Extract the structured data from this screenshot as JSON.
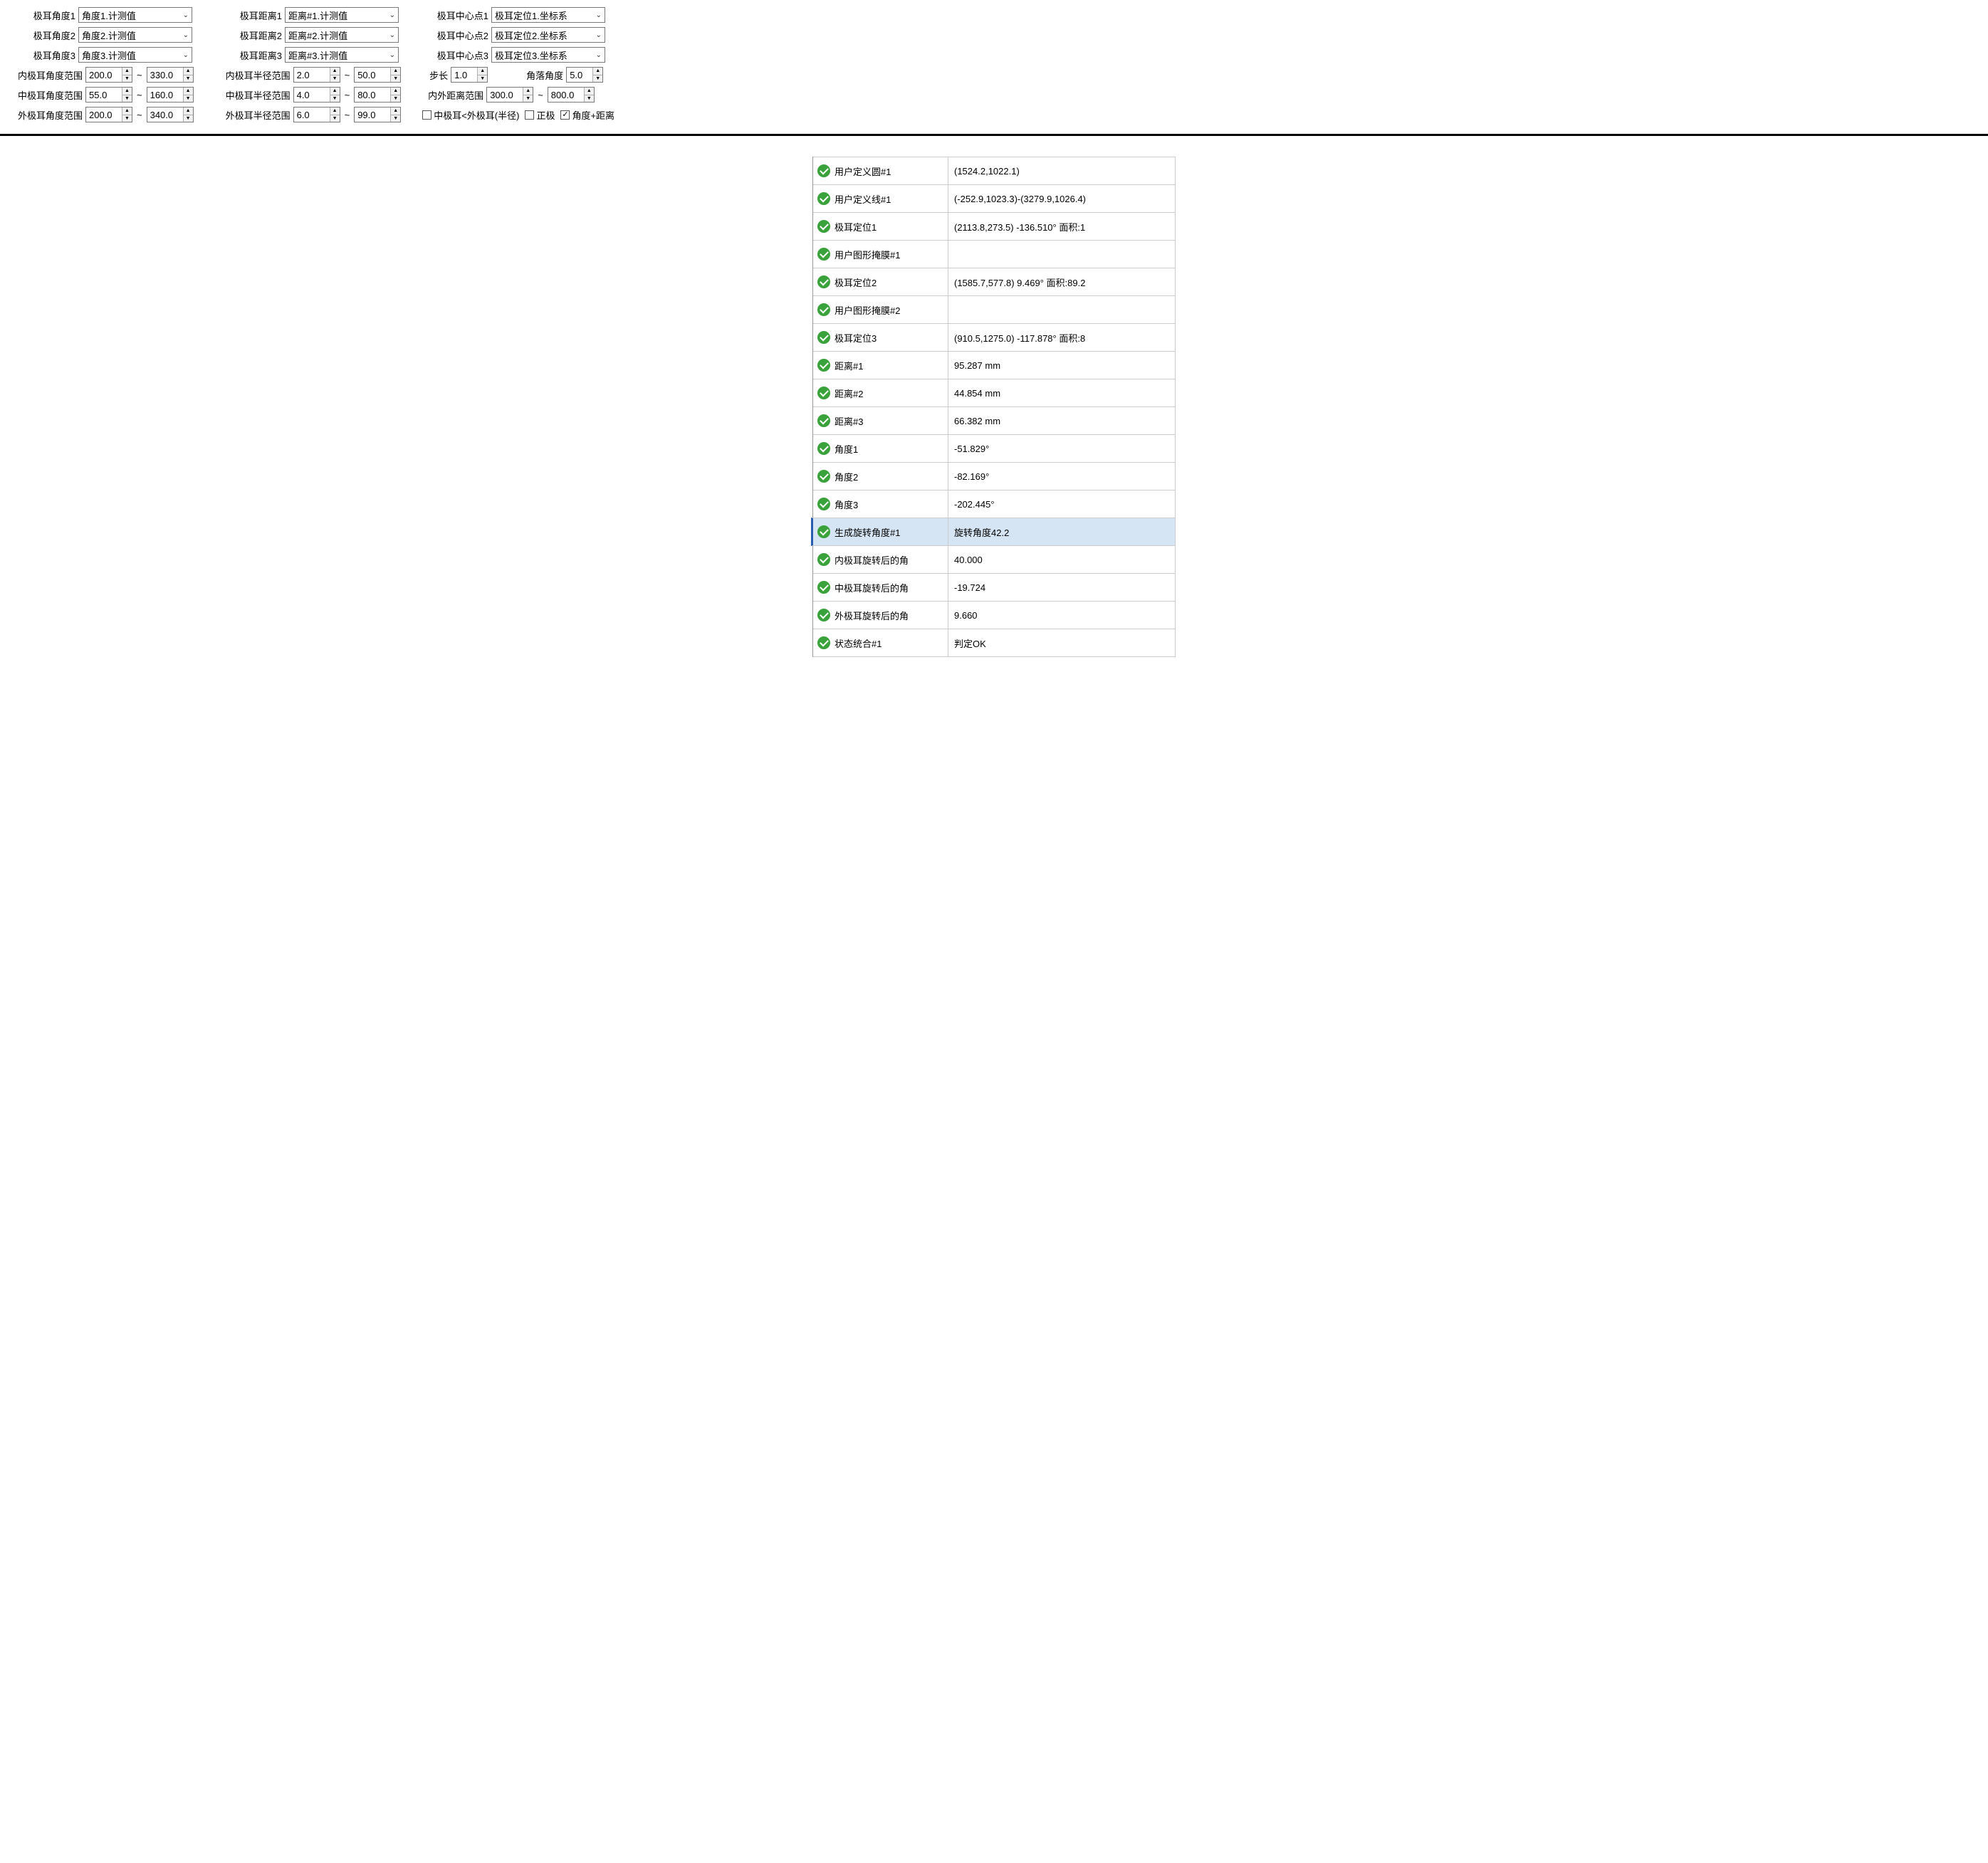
{
  "topRow1": {
    "c1": {
      "label": "极耳角度1",
      "combo": "角度1.计测值"
    },
    "c2": {
      "label": "极耳距离1",
      "combo": "距离#1.计测值"
    },
    "c3": {
      "label": "极耳中心点1",
      "combo": "极耳定位1.坐标系"
    }
  },
  "topRow2": {
    "c1": {
      "label": "极耳角度2",
      "combo": "角度2.计测值"
    },
    "c2": {
      "label": "极耳距离2",
      "combo": "距离#2.计测值"
    },
    "c3": {
      "label": "极耳中心点2",
      "combo": "极耳定位2.坐标系"
    }
  },
  "topRow3": {
    "c1": {
      "label": "极耳角度3",
      "combo": "角度3.计测值"
    },
    "c2": {
      "label": "极耳距离3",
      "combo": "距离#3.计测值"
    },
    "c3": {
      "label": "极耳中心点3",
      "combo": "极耳定位3.坐标系"
    }
  },
  "rangeRow1": {
    "aLabel": "内极耳角度范围",
    "aMin": "200.0",
    "aMax": "330.0",
    "rLabel": "内极耳半径范围",
    "rMin": "2.0",
    "rMax": "50.0",
    "stepLabel": "步长",
    "step": "1.0",
    "cornerLabel": "角落角度",
    "corner": "5.0"
  },
  "rangeRow2": {
    "aLabel": "中极耳角度范围",
    "aMin": "55.0",
    "aMax": "160.0",
    "rLabel": "中极耳半径范围",
    "rMin": "4.0",
    "rMax": "80.0",
    "distLabel": "内外距离范围",
    "distMin": "300.0",
    "distMax": "800.0"
  },
  "rangeRow3": {
    "aLabel": "外极耳角度范围",
    "aMin": "200.0",
    "aMax": "340.0",
    "rLabel": "外极耳半径范围",
    "rMin": "6.0",
    "rMax": "99.0",
    "cb1": "中极耳<外极耳(半径)",
    "cb1Checked": false,
    "cb2": "正极",
    "cb2Checked": false,
    "cb3": "角度+距离",
    "cb3Checked": true
  },
  "tilde": "~",
  "results": [
    {
      "name": "用户定义圆#1",
      "value": "(1524.2,1022.1)",
      "selected": false
    },
    {
      "name": "用户定义线#1",
      "value": "(-252.9,1023.3)-(3279.9,1026.4)",
      "selected": false
    },
    {
      "name": "极耳定位1",
      "value": "(2113.8,273.5) -136.510° 面积:1",
      "selected": false
    },
    {
      "name": "用户图形掩膜#1",
      "value": "",
      "selected": false
    },
    {
      "name": "极耳定位2",
      "value": "(1585.7,577.8) 9.469° 面积:89.2",
      "selected": false
    },
    {
      "name": "用户图形掩膜#2",
      "value": "",
      "selected": false
    },
    {
      "name": "极耳定位3",
      "value": "(910.5,1275.0) -117.878° 面积:8",
      "selected": false
    },
    {
      "name": "距离#1",
      "value": "95.287 mm",
      "selected": false
    },
    {
      "name": "距离#2",
      "value": "44.854 mm",
      "selected": false
    },
    {
      "name": "距离#3",
      "value": "66.382 mm",
      "selected": false
    },
    {
      "name": "角度1",
      "value": "-51.829°",
      "selected": false
    },
    {
      "name": "角度2",
      "value": "-82.169°",
      "selected": false
    },
    {
      "name": "角度3",
      "value": "-202.445°",
      "selected": false
    },
    {
      "name": "生成旋转角度#1",
      "value": "旋转角度42.2",
      "selected": true
    },
    {
      "name": "内极耳旋转后的角",
      "value": "40.000",
      "selected": false
    },
    {
      "name": "中极耳旋转后的角",
      "value": "-19.724",
      "selected": false
    },
    {
      "name": "外极耳旋转后的角",
      "value": "9.660",
      "selected": false
    },
    {
      "name": "状态统合#1",
      "value": "判定OK",
      "selected": false
    }
  ]
}
